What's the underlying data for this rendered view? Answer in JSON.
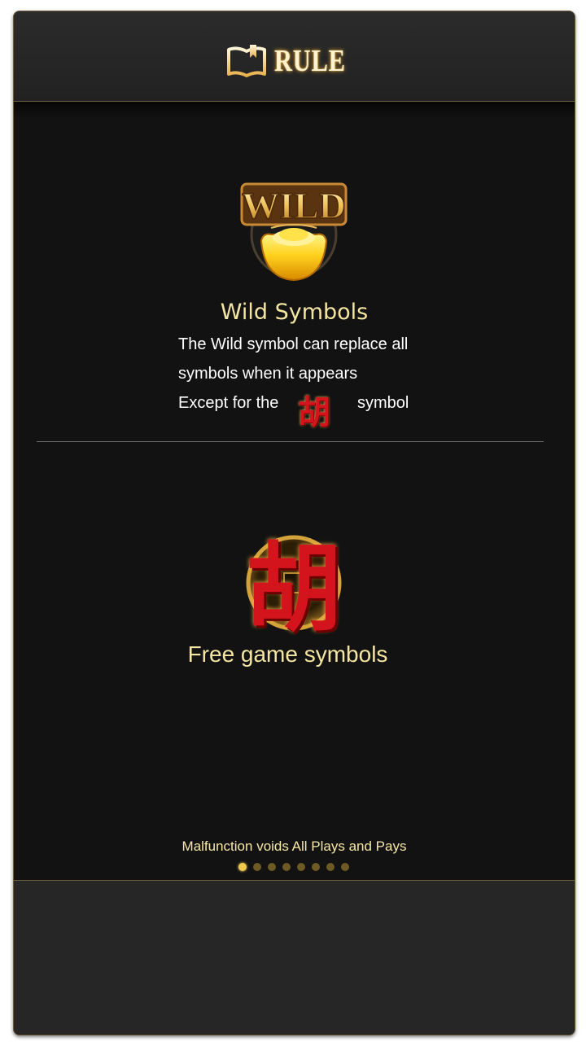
{
  "header": {
    "title": "RULE",
    "icon": "book-icon"
  },
  "wild": {
    "title": "Wild Symbols",
    "logo_text": "WILD",
    "line1": "The Wild symbol can replace all",
    "line2": "symbols when it appears",
    "line3_before": "Except for the",
    "line3_after": "symbol"
  },
  "free": {
    "title": "Free game symbols",
    "symbol_char": "胡"
  },
  "footer": {
    "note": "Malfunction voids All Plays and Pays"
  },
  "pagination": {
    "total": 8,
    "active_index": 0
  },
  "colors": {
    "gold_title": "#f4e6a2",
    "accent_gold": "#f2c94c",
    "symbol_red": "#d4141c"
  }
}
